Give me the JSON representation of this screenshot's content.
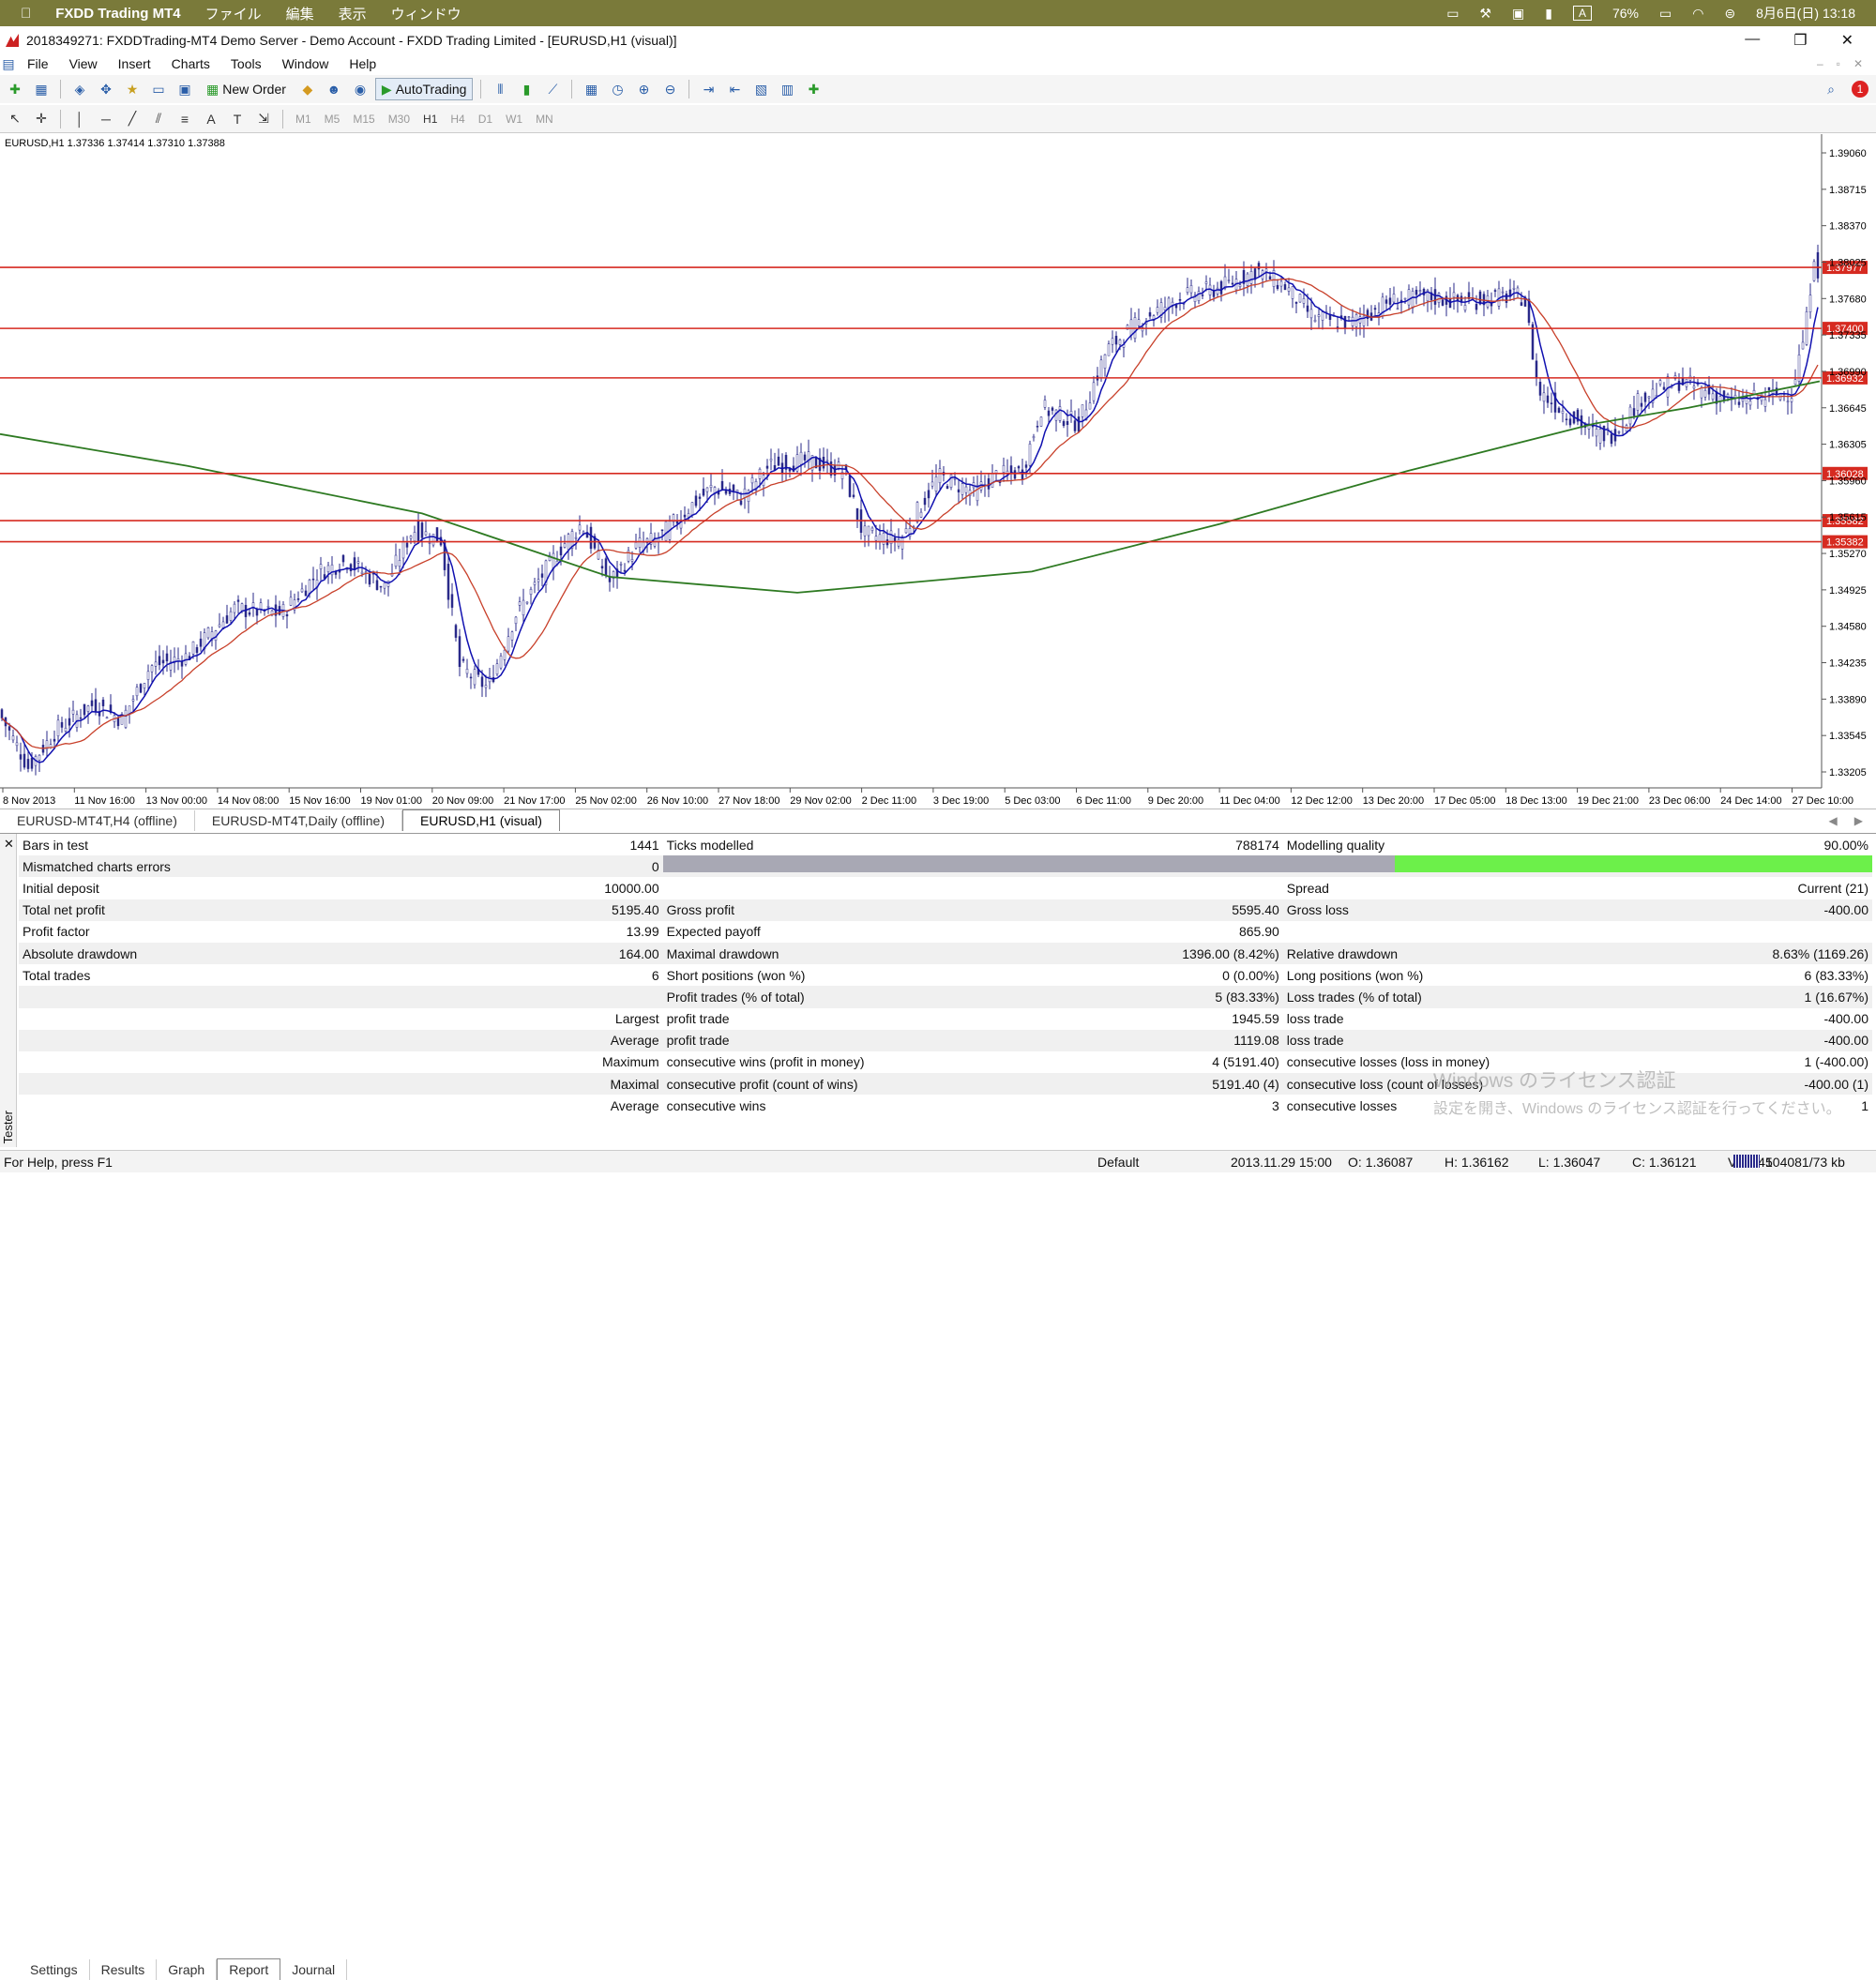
{
  "macbar": {
    "app_name": "FXDD Trading MT4",
    "menus": [
      "ファイル",
      "編集",
      "表示",
      "ウィンドウ"
    ],
    "input_label": "A",
    "battery": "76%",
    "datetime": "8月6日(日) 13:18"
  },
  "window": {
    "title": "2018349271: FXDDTrading-MT4 Demo Server - Demo Account - FXDD Trading Limited - [EURUSD,H1 (visual)]",
    "minimize": "—",
    "restore": "❐",
    "close": "✕"
  },
  "menu": [
    "File",
    "View",
    "Insert",
    "Charts",
    "Tools",
    "Window",
    "Help"
  ],
  "toolbar": {
    "new_order": "New Order",
    "autotrading": "AutoTrading",
    "timeframes": [
      "M1",
      "M5",
      "M15",
      "M30",
      "H1",
      "H4",
      "D1",
      "W1",
      "MN"
    ],
    "selected_timeframe": "H1",
    "notifications": "1"
  },
  "chart": {
    "header": "EURUSD,H1  1.37336 1.37414 1.37310 1.37388",
    "price_labels": [
      "1.39060",
      "1.38715",
      "1.38370",
      "1.38025",
      "1.37680",
      "1.37335",
      "1.36990",
      "1.36645",
      "1.36305",
      "1.35960",
      "1.35615",
      "1.35270",
      "1.34925",
      "1.34580",
      "1.34235",
      "1.33890",
      "1.33545",
      "1.33205"
    ],
    "hlines": [
      {
        "label": "1.37977",
        "color": "#d62a20"
      },
      {
        "label": "1.37400",
        "color": "#d62a20"
      },
      {
        "label": "1.36932",
        "color": "#d62a20"
      },
      {
        "label": "1.36028",
        "color": "#d62a20"
      },
      {
        "label": "1.35582",
        "color": "#d62a20"
      },
      {
        "label": "1.35382",
        "color": "#d62a20"
      }
    ],
    "dates": [
      "8 Nov 2013",
      "11 Nov 16:00",
      "13 Nov 00:00",
      "14 Nov 08:00",
      "15 Nov 16:00",
      "19 Nov 01:00",
      "20 Nov 09:00",
      "21 Nov 17:00",
      "25 Nov 02:00",
      "26 Nov 10:00",
      "27 Nov 18:00",
      "29 Nov 02:00",
      "2 Dec 11:00",
      "3 Dec 19:00",
      "5 Dec 03:00",
      "6 Dec 11:00",
      "9 Dec 20:00",
      "11 Dec 04:00",
      "12 Dec 12:00",
      "13 Dec 20:00",
      "17 Dec 05:00",
      "18 Dec 13:00",
      "19 Dec 21:00",
      "23 Dec 06:00",
      "24 Dec 14:00",
      "27 Dec 10:00"
    ],
    "colors": {
      "candle": "#2a2a8a",
      "blue_ma": "#1010b0",
      "red_ma": "#c8402a",
      "green_ma": "#2e7a22"
    }
  },
  "chart_tabs": [
    "EURUSD-MT4T,H4 (offline)",
    "EURUSD-MT4T,Daily (offline)",
    "EURUSD,H1 (visual)"
  ],
  "report": {
    "rows": [
      [
        "Bars in test",
        "1441",
        "Ticks modelled",
        "788174",
        "Modelling quality",
        "90.00%"
      ],
      [
        "Mismatched charts errors",
        "0",
        "",
        "",
        "",
        ""
      ],
      [
        "Initial deposit",
        "10000.00",
        "",
        "",
        "Spread",
        "Current (21)"
      ],
      [
        "Total net profit",
        "5195.40",
        "Gross profit",
        "5595.40",
        "Gross loss",
        "-400.00"
      ],
      [
        "Profit factor",
        "13.99",
        "Expected payoff",
        "865.90",
        "",
        ""
      ],
      [
        "Absolute drawdown",
        "164.00",
        "Maximal drawdown",
        "1396.00 (8.42%)",
        "Relative drawdown",
        "8.63% (1169.26)"
      ],
      [
        "Total trades",
        "6",
        "Short positions (won %)",
        "0 (0.00%)",
        "Long positions (won %)",
        "6 (83.33%)"
      ],
      [
        "",
        "",
        "Profit trades (% of total)",
        "5 (83.33%)",
        "Loss trades (% of total)",
        "1 (16.67%)"
      ],
      [
        "",
        "Largest",
        "profit trade",
        "1945.59",
        "loss trade",
        "-400.00"
      ],
      [
        "",
        "Average",
        "profit trade",
        "1119.08",
        "loss trade",
        "-400.00"
      ],
      [
        "",
        "Maximum",
        "consecutive wins (profit in money)",
        "4 (5191.40)",
        "consecutive losses (loss in money)",
        "1 (-400.00)"
      ],
      [
        "",
        "Maximal",
        "consecutive profit (count of wins)",
        "5191.40 (4)",
        "consecutive loss (count of losses)",
        "-400.00 (1)"
      ],
      [
        "",
        "Average",
        "consecutive wins",
        "3",
        "consecutive losses",
        "1"
      ]
    ],
    "modelling_quality_fraction": 0.9
  },
  "watermark": {
    "line1": "Windows のライセンス認証",
    "line2": "設定を開き、Windows のライセンス認証を行ってください。"
  },
  "tester": {
    "close": "✕",
    "label": "Tester",
    "tabs": [
      "Settings",
      "Results",
      "Graph",
      "Report",
      "Journal"
    ],
    "active_tab": "Report"
  },
  "status": {
    "help": "For Help, press F1",
    "profile": "Default",
    "time": "2013.11.29 15:00",
    "open": "O: 1.36087",
    "high": "H: 1.36162",
    "low": "L: 1.36047",
    "close": "C: 1.36121",
    "volume": "V: 2945",
    "traffic": "104081/73 kb"
  }
}
